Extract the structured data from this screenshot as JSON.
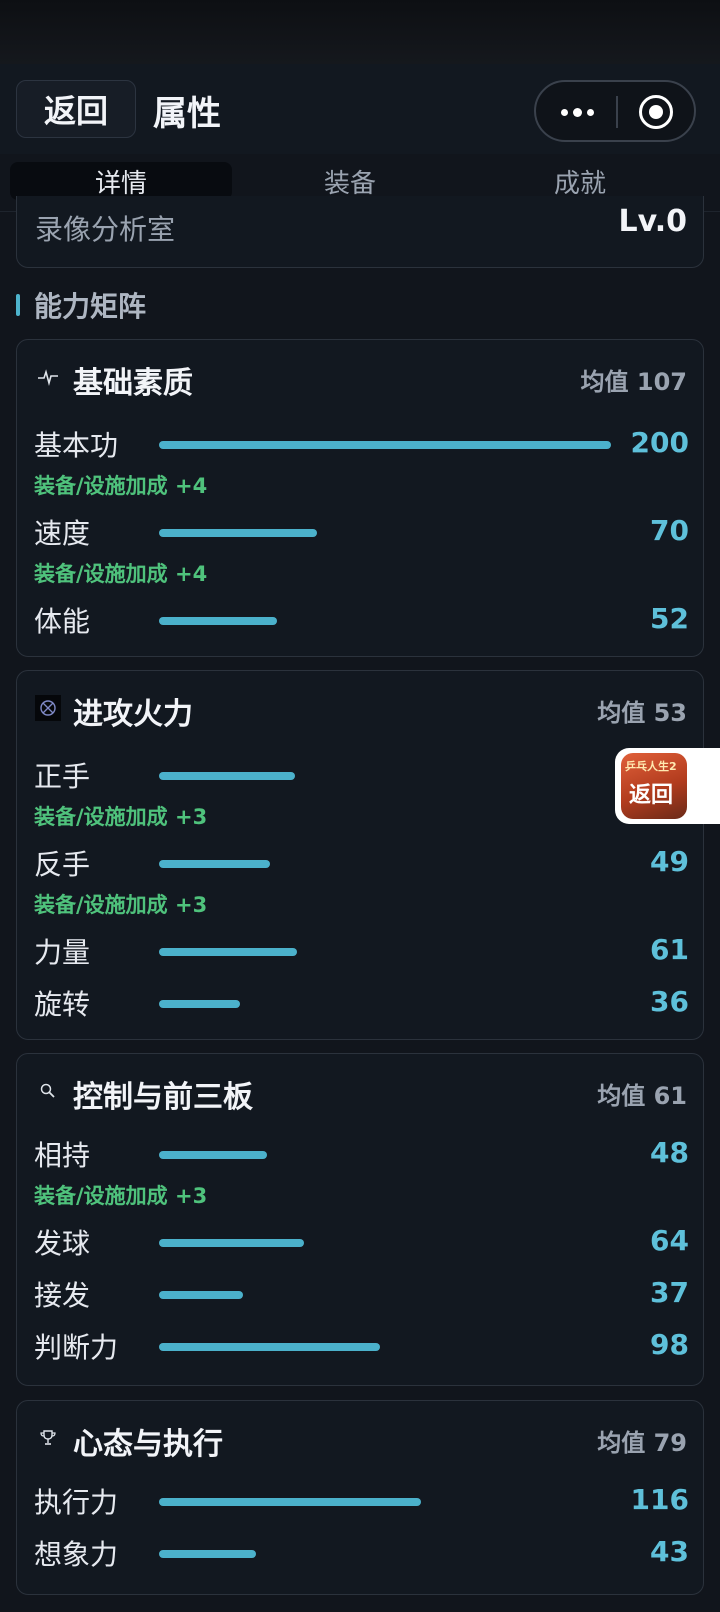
{
  "header": {
    "back_label": "返回",
    "title": "属性"
  },
  "tabs": [
    {
      "label": "详情",
      "active": true
    },
    {
      "label": "装备",
      "active": false
    },
    {
      "label": "成就",
      "active": false
    }
  ],
  "facility": {
    "label": "录像分析室",
    "value": "Lv.0"
  },
  "section_title": "能力矩阵",
  "cards": [
    {
      "icon": "pulse-icon",
      "title": "基础素质",
      "avg": "均值 107",
      "stats": [
        {
          "name": "基本功",
          "value": "200",
          "level": 200,
          "bonus": "装备/设施加成 +4"
        },
        {
          "name": "速度",
          "value": "70",
          "level": 70,
          "bonus": "装备/设施加成 +4"
        },
        {
          "name": "体能",
          "value": "52",
          "level": 52
        }
      ]
    },
    {
      "icon": "crosshair-icon",
      "title": "进攻火力",
      "avg": "均值 53",
      "stats": [
        {
          "name": "正手",
          "value": "60",
          "level": 60,
          "bonus": "装备/设施加成 +3"
        },
        {
          "name": "反手",
          "value": "49",
          "level": 49,
          "bonus": "装备/设施加成 +3"
        },
        {
          "name": "力量",
          "value": "61",
          "level": 61
        },
        {
          "name": "旋转",
          "value": "36",
          "level": 36
        }
      ]
    },
    {
      "icon": "magnifier-icon",
      "title": "控制与前三板",
      "avg": "均值 61",
      "stats": [
        {
          "name": "相持",
          "value": "48",
          "level": 48,
          "bonus": "装备/设施加成 +3"
        },
        {
          "name": "发球",
          "value": "64",
          "level": 64
        },
        {
          "name": "接发",
          "value": "37",
          "level": 37
        },
        {
          "name": "判断力",
          "value": "98",
          "level": 98
        }
      ]
    },
    {
      "icon": "trophy-icon",
      "title": "心态与执行",
      "avg": "均值 79",
      "stats": [
        {
          "name": "执行力",
          "value": "116",
          "level": 116
        },
        {
          "name": "想象力",
          "value": "43",
          "level": 43
        }
      ]
    }
  ],
  "float_button": {
    "app_name": "乒乓人生2",
    "label": "返回"
  },
  "colors": {
    "accent": "#4bb1cb",
    "bonus": "#4fc27c",
    "background": "#11151c"
  }
}
